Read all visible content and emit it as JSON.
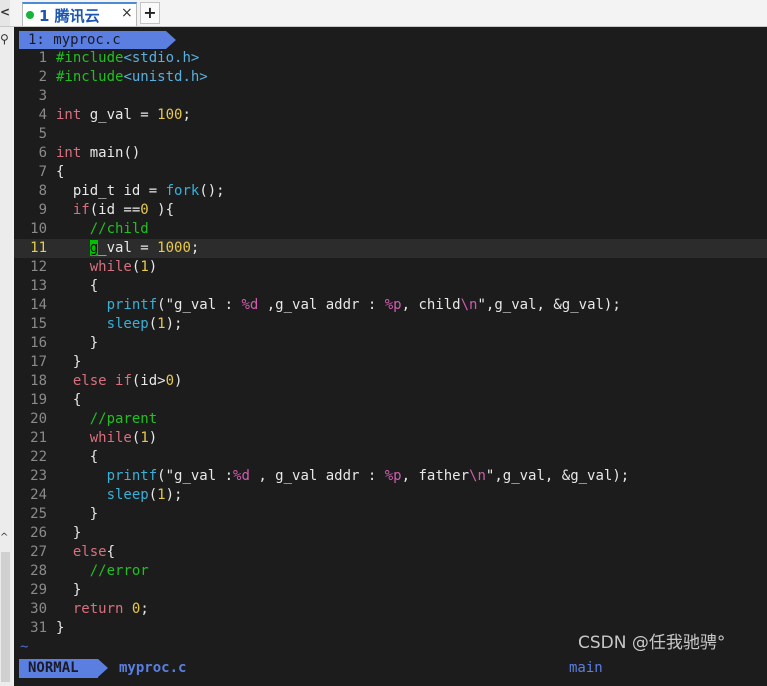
{
  "tab": {
    "index_label": "1",
    "title": "腾讯云",
    "close_icon": "×",
    "new_tab": "+"
  },
  "left": {
    "prev": "<",
    "search_icon": "search-icon",
    "chevron": "^"
  },
  "editor": {
    "tabline": "1: myproc.c",
    "cursor_line": 11,
    "lines": [
      {
        "n": "1",
        "code": "#include<stdio.h>"
      },
      {
        "n": "2",
        "code": "#include<unistd.h>"
      },
      {
        "n": "3",
        "code": ""
      },
      {
        "n": "4",
        "code": "int g_val = 100;"
      },
      {
        "n": "5",
        "code": ""
      },
      {
        "n": "6",
        "code": "int main()"
      },
      {
        "n": "7",
        "code": "{"
      },
      {
        "n": "8",
        "code": "  pid_t id = fork();"
      },
      {
        "n": "9",
        "code": "  if(id ==0 ){"
      },
      {
        "n": "10",
        "code": "    //child"
      },
      {
        "n": "11",
        "code": "    g_val = 1000;"
      },
      {
        "n": "12",
        "code": "    while(1)"
      },
      {
        "n": "13",
        "code": "    {"
      },
      {
        "n": "14",
        "code": "      printf(\"g_val : %d ,g_val addr : %p, child\\n\",g_val, &g_val);"
      },
      {
        "n": "15",
        "code": "      sleep(1);"
      },
      {
        "n": "16",
        "code": "    }"
      },
      {
        "n": "17",
        "code": "  }"
      },
      {
        "n": "18",
        "code": "  else if(id>0)"
      },
      {
        "n": "19",
        "code": "  {"
      },
      {
        "n": "20",
        "code": "    //parent"
      },
      {
        "n": "21",
        "code": "    while(1)"
      },
      {
        "n": "22",
        "code": "    {"
      },
      {
        "n": "23",
        "code": "      printf(\"g_val :%d , g_val addr : %p, father\\n\",g_val, &g_val);"
      },
      {
        "n": "24",
        "code": "      sleep(1);"
      },
      {
        "n": "25",
        "code": "    }"
      },
      {
        "n": "26",
        "code": "  }"
      },
      {
        "n": "27",
        "code": "  else{"
      },
      {
        "n": "28",
        "code": "    //error"
      },
      {
        "n": "29",
        "code": "  }"
      },
      {
        "n": "30",
        "code": "  return 0;"
      },
      {
        "n": "31",
        "code": "}"
      }
    ],
    "tilde": "~"
  },
  "statusline": {
    "mode": "NORMAL",
    "file": "myproc.c",
    "right": "main"
  },
  "watermark": "CSDN @任我驰骋°",
  "colors": {
    "keyword": "#d8707e",
    "comment": "#20c020",
    "preproc": "#58b0e0",
    "number": "#e8c94a",
    "function": "#38b0d8",
    "accent": "#5a7fe0",
    "cursor": "#00c000"
  }
}
